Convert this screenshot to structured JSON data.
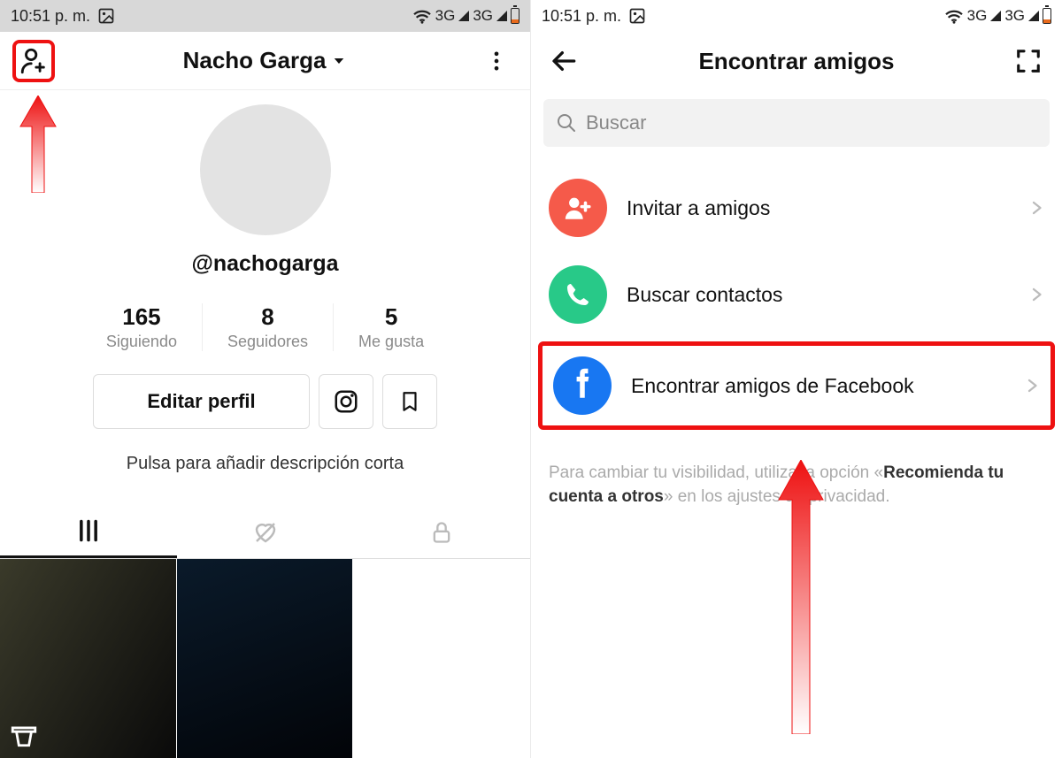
{
  "status": {
    "time": "10:51 p. m.",
    "signal": "3G"
  },
  "left": {
    "header_title": "Nacho Garga",
    "handle": "@nachogarga",
    "stats": {
      "following_num": "165",
      "following_label": "Siguiendo",
      "followers_num": "8",
      "followers_label": "Seguidores",
      "likes_num": "5",
      "likes_label": "Me gusta"
    },
    "edit_label": "Editar perfil",
    "bio_hint": "Pulsa para añadir descripción corta"
  },
  "right": {
    "header_title": "Encontrar amigos",
    "search_placeholder": "Buscar",
    "options": {
      "invite": "Invitar a amigos",
      "contacts": "Buscar contactos",
      "facebook": "Encontrar amigos de Facebook"
    },
    "hint_pre": "Para cambiar tu visibilidad, utiliza la opción «",
    "hint_bold": "Recomienda tu cuenta a otros",
    "hint_post": "» en los ajustes de privacidad."
  }
}
